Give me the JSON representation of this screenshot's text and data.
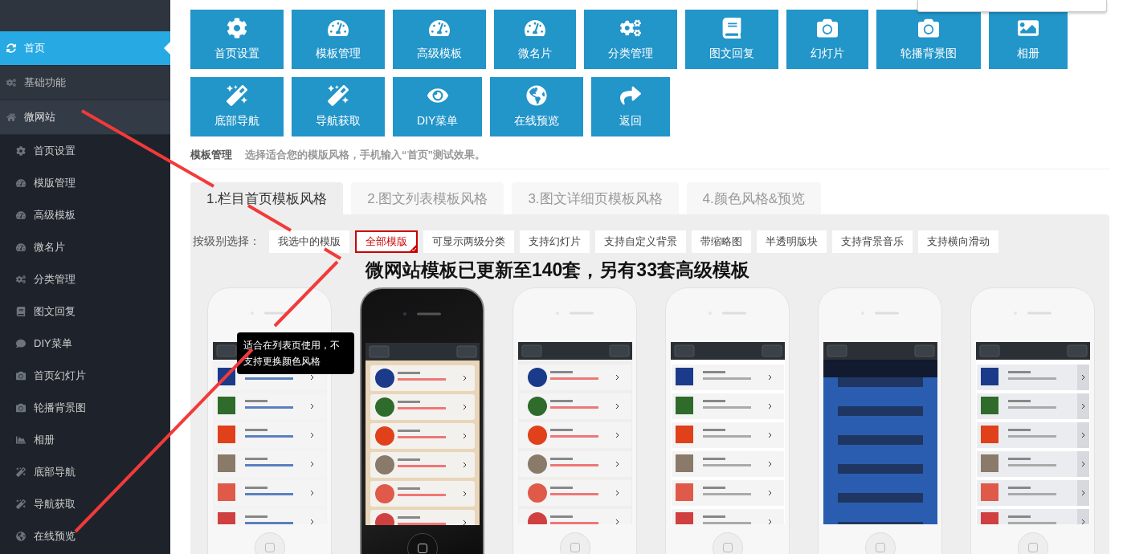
{
  "sidebar": {
    "items": [
      {
        "label": "首页",
        "selected": true
      },
      {
        "label": "基础功能",
        "selected": false
      },
      {
        "label": "微网站",
        "selected": false,
        "expanded": true,
        "children": [
          {
            "label": "首页设置",
            "selected": false
          },
          {
            "label": "模版管理",
            "selected": false
          },
          {
            "label": "高级模板",
            "selected": false
          },
          {
            "label": "微名片",
            "selected": false
          },
          {
            "label": "分类管理",
            "selected": false
          },
          {
            "label": "图文回复",
            "selected": false
          },
          {
            "label": "DIY菜单",
            "selected": false
          },
          {
            "label": "首页幻灯片",
            "selected": false
          },
          {
            "label": "轮播背景图",
            "selected": false
          },
          {
            "label": "相册",
            "selected": false
          },
          {
            "label": "底部导航",
            "selected": false
          },
          {
            "label": "导航获取",
            "selected": false
          },
          {
            "label": "在线预览",
            "selected": false
          }
        ]
      }
    ]
  },
  "toolbar_rows": [
    [
      "首页设置",
      "模板管理",
      "高级模板",
      "微名片",
      "分类管理",
      "图文回复",
      "幻灯片",
      "轮播背景图",
      "相册"
    ],
    [
      "底部导航",
      "导航获取",
      "DIY菜单",
      "在线预览",
      "返回"
    ]
  ],
  "section": {
    "title": "模板管理",
    "hint": "选择适合您的模版风格，手机输入“首页”测试效果。"
  },
  "tabs": [
    {
      "label": "1.栏目首页模板风格",
      "selected": true
    },
    {
      "label": "2.图文列表模板风格",
      "selected": false
    },
    {
      "label": "3.图文详细页模板风格",
      "selected": false
    },
    {
      "label": "4.颜色风格&预览",
      "selected": false
    }
  ],
  "filter": {
    "label": "按级别选择：",
    "options": [
      {
        "label": "我选中的模版",
        "selected": false
      },
      {
        "label": "全部模版",
        "selected": true
      },
      {
        "label": "可显示两级分类",
        "selected": false
      },
      {
        "label": "支持幻灯片",
        "selected": false
      },
      {
        "label": "支持自定义背景",
        "selected": false
      },
      {
        "label": "带缩略图",
        "selected": false
      },
      {
        "label": "半透明版块",
        "selected": false
      },
      {
        "label": "支持背景音乐",
        "selected": false
      },
      {
        "label": "支持横向滑动",
        "selected": false
      }
    ]
  },
  "headline": "微网站模板已更新至140套，另有33套高级模板",
  "templates": [
    {
      "kind": "square",
      "selected": false
    },
    {
      "kind": "card",
      "selected": true
    },
    {
      "kind": "round",
      "selected": false
    },
    {
      "kind": "spaced",
      "selected": false
    },
    {
      "kind": "background",
      "selected": false
    },
    {
      "kind": "arrow",
      "selected": false
    }
  ],
  "tooltip": "适合在列表页使用，不支持更换颜色风格"
}
